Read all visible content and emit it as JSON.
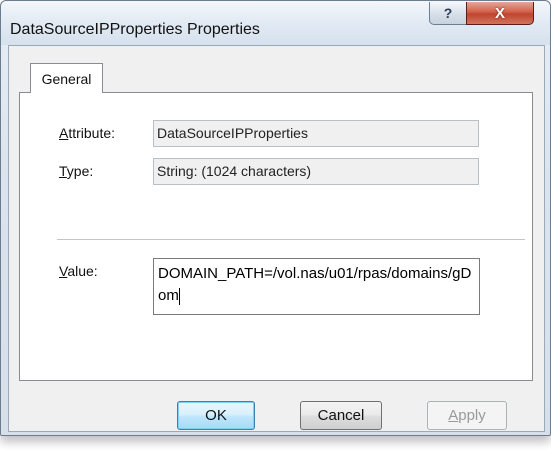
{
  "window": {
    "title": "DataSourceIPProperties Properties"
  },
  "title_buttons": {
    "help_symbol": "?",
    "close_symbol": "X"
  },
  "tabs": [
    {
      "label": "General",
      "selected": true
    }
  ],
  "fields": {
    "attribute": {
      "label_accel": "A",
      "label_rest": "ttribute:",
      "value": "DataSourceIPProperties"
    },
    "type": {
      "label_accel": "T",
      "label_rest": "ype:",
      "value": "String: (1024 characters)"
    },
    "value": {
      "label_accel": "V",
      "label_rest": "alue:",
      "text": "DOMAIN_PATH=/vol.nas/u01/rpas/domains/gDom"
    }
  },
  "buttons": {
    "ok": "OK",
    "cancel": "Cancel",
    "apply_accel": "A",
    "apply_rest": "pply"
  }
}
